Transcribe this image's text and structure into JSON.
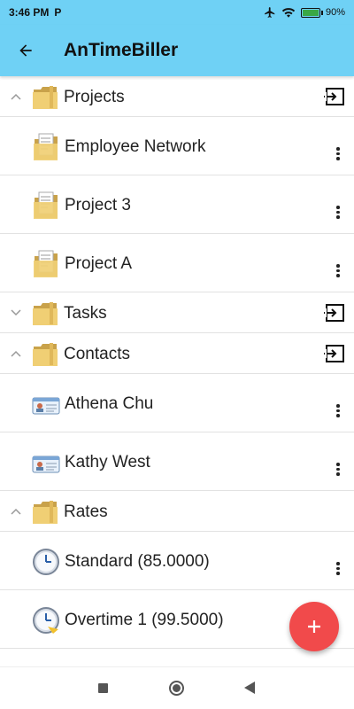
{
  "status_bar": {
    "time": "3:46 PM",
    "carrier_glyph": "P",
    "battery": "90%",
    "battery_level": 0.9
  },
  "app_bar": {
    "title": "AnTimeBiller"
  },
  "groups": [
    {
      "label": "Projects",
      "expanded": true,
      "icon": "folder-icon",
      "has_export": true,
      "items": [
        {
          "label": "Employee Network",
          "icon": "project-folder-icon"
        },
        {
          "label": "Project 3",
          "icon": "project-folder-icon"
        },
        {
          "label": "Project A",
          "icon": "project-folder-icon"
        }
      ]
    },
    {
      "label": "Tasks",
      "expanded": false,
      "icon": "folder-icon",
      "has_export": true,
      "items": []
    },
    {
      "label": "Contacts",
      "expanded": true,
      "icon": "folder-icon",
      "has_export": true,
      "items": [
        {
          "label": "Athena Chu",
          "icon": "contact-card-icon"
        },
        {
          "label": "Kathy West",
          "icon": "contact-card-icon"
        }
      ]
    },
    {
      "label": "Rates",
      "expanded": true,
      "icon": "folder-icon",
      "has_export": false,
      "items": [
        {
          "label": "Standard (85.0000)",
          "icon": "clock-icon"
        },
        {
          "label": "Overtime 1 (99.5000)",
          "icon": "clock-overtime-icon"
        }
      ]
    }
  ],
  "fab": {
    "icon": "plus-icon"
  },
  "nav_bar": {
    "buttons": [
      "recents-square-icon",
      "home-circle-icon",
      "back-triangle-icon"
    ]
  },
  "colors": {
    "app_bar": "#6fd1f5",
    "fab": "#f14a4b",
    "folder": "#e8c46a",
    "divider": "#e2e2e2"
  }
}
